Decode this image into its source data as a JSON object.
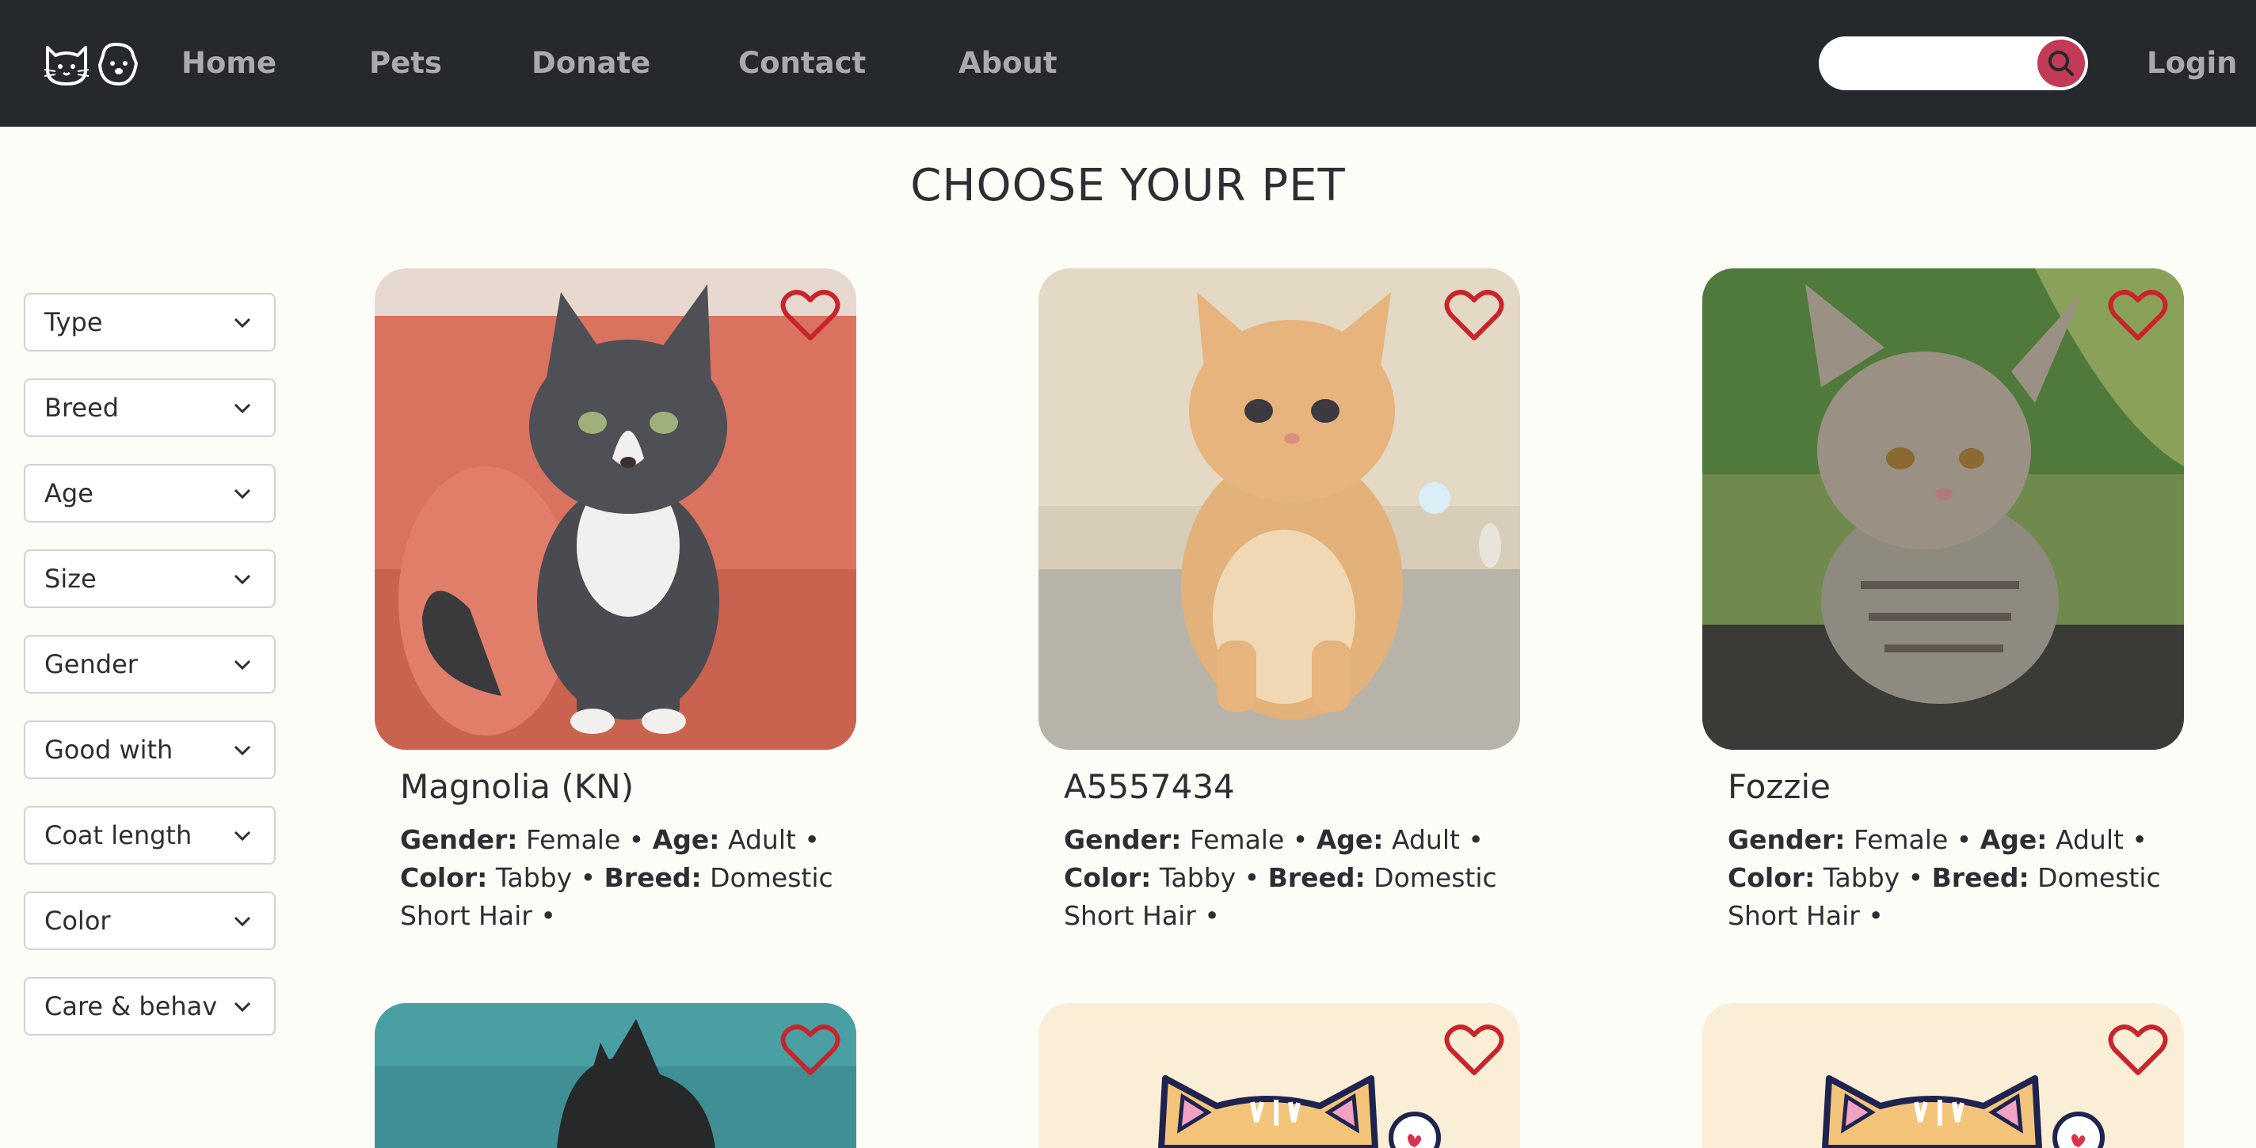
{
  "nav": {
    "logo": "cat-dog-logo",
    "links": [
      "Home",
      "Pets",
      "Donate",
      "Contact",
      "About"
    ],
    "search": {
      "placeholder": "",
      "icon": "search-icon"
    },
    "login": "Login"
  },
  "page_title": "CHOOSE YOUR PET",
  "filters": [
    "Type",
    "Breed",
    "Age",
    "Size",
    "Gender",
    "Good with",
    "Coat length",
    "Color",
    "Care & behav"
  ],
  "colors": {
    "nav_bg": "#25282d",
    "accent": "#c23a55",
    "heart": "#c9242b",
    "page_bg": "#fdfdf8"
  },
  "labels": {
    "gender": "Gender:",
    "age": "Age:",
    "color": "Color:",
    "breed": "Breed:"
  },
  "pets": [
    {
      "name": "Magnolia (KN)",
      "gender": "Female",
      "age": "Adult",
      "color": "Tabby",
      "breed": "Domestic Short Hair"
    },
    {
      "name": "A5557434",
      "gender": "Female",
      "age": "Adult",
      "color": "Tabby",
      "breed": "Domestic Short Hair"
    },
    {
      "name": "Fozzie",
      "gender": "Female",
      "age": "Adult",
      "color": "Tabby",
      "breed": "Domestic Short Hair"
    }
  ]
}
